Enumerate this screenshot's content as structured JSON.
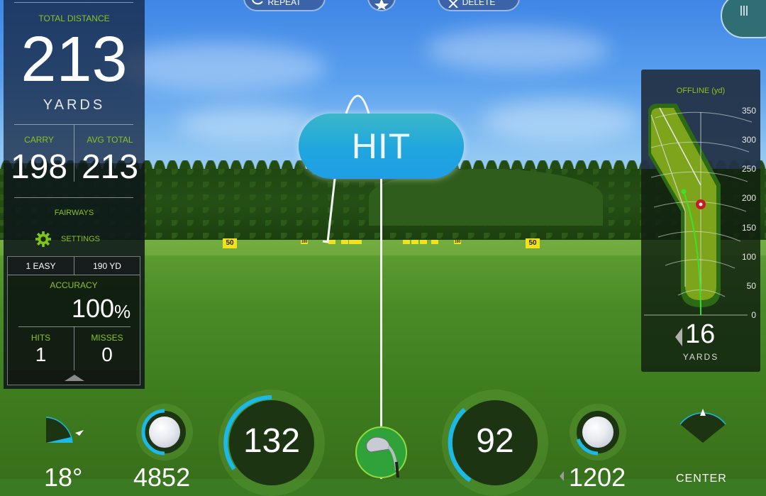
{
  "top_bar": {
    "repeat_label": "REPEAT",
    "delete_label": "DELETE",
    "favorite_icon": "star-icon",
    "menu_icon": "menu-icon"
  },
  "shot_result": {
    "label": "HIT"
  },
  "range": {
    "flags": [
      "50",
      "100",
      "100",
      "50"
    ]
  },
  "left_panel": {
    "total_distance_label": "TOTAL DISTANCE",
    "total_distance_value": "213",
    "total_distance_unit": "YARDS",
    "carry_label": "CARRY",
    "carry_value": "198",
    "avg_total_label": "AVG TOTAL",
    "avg_total_value": "213",
    "mode_label": "FAIRWAYS",
    "settings_label": "SETTINGS",
    "difficulty": "1 EASY",
    "target_distance": "190 YD",
    "accuracy_label": "ACCURACY",
    "accuracy_value": "100",
    "accuracy_unit": "%",
    "hits_label": "HITS",
    "hits_value": "1",
    "misses_label": "MISSES",
    "misses_value": "0"
  },
  "right_panel": {
    "title": "OFFLINE (yd)",
    "y_ticks": [
      "350",
      "300",
      "250",
      "200",
      "150",
      "100",
      "50",
      "0"
    ],
    "offline_value": "16",
    "offline_direction": "left",
    "offline_unit": "YARDS"
  },
  "bottom_gauges": {
    "launch_angle": "18°",
    "back_spin": "4852",
    "ball_speed": "132",
    "club_speed": "92",
    "side_spin": "1202",
    "side_spin_direction": "left",
    "launch_direction": "CENTER",
    "club_icon": "iron-club-icon"
  }
}
